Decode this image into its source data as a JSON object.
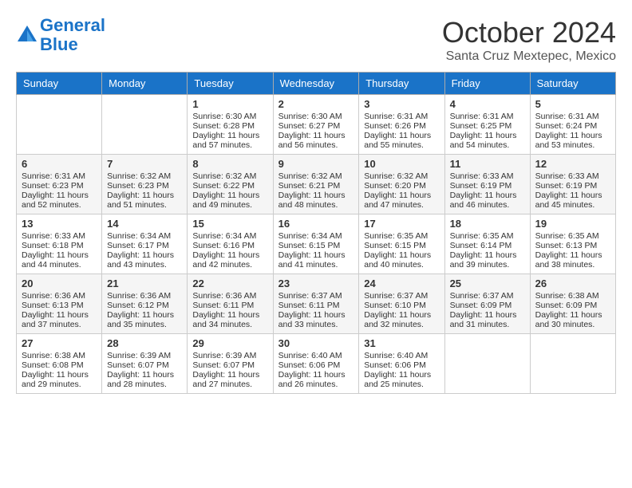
{
  "header": {
    "logo_line1": "General",
    "logo_line2": "Blue",
    "month": "October 2024",
    "location": "Santa Cruz Mextepec, Mexico"
  },
  "days_of_week": [
    "Sunday",
    "Monday",
    "Tuesday",
    "Wednesday",
    "Thursday",
    "Friday",
    "Saturday"
  ],
  "weeks": [
    [
      {
        "day": "",
        "sunrise": "",
        "sunset": "",
        "daylight": ""
      },
      {
        "day": "",
        "sunrise": "",
        "sunset": "",
        "daylight": ""
      },
      {
        "day": "1",
        "sunrise": "Sunrise: 6:30 AM",
        "sunset": "Sunset: 6:28 PM",
        "daylight": "Daylight: 11 hours and 57 minutes."
      },
      {
        "day": "2",
        "sunrise": "Sunrise: 6:30 AM",
        "sunset": "Sunset: 6:27 PM",
        "daylight": "Daylight: 11 hours and 56 minutes."
      },
      {
        "day": "3",
        "sunrise": "Sunrise: 6:31 AM",
        "sunset": "Sunset: 6:26 PM",
        "daylight": "Daylight: 11 hours and 55 minutes."
      },
      {
        "day": "4",
        "sunrise": "Sunrise: 6:31 AM",
        "sunset": "Sunset: 6:25 PM",
        "daylight": "Daylight: 11 hours and 54 minutes."
      },
      {
        "day": "5",
        "sunrise": "Sunrise: 6:31 AM",
        "sunset": "Sunset: 6:24 PM",
        "daylight": "Daylight: 11 hours and 53 minutes."
      }
    ],
    [
      {
        "day": "6",
        "sunrise": "Sunrise: 6:31 AM",
        "sunset": "Sunset: 6:23 PM",
        "daylight": "Daylight: 11 hours and 52 minutes."
      },
      {
        "day": "7",
        "sunrise": "Sunrise: 6:32 AM",
        "sunset": "Sunset: 6:23 PM",
        "daylight": "Daylight: 11 hours and 51 minutes."
      },
      {
        "day": "8",
        "sunrise": "Sunrise: 6:32 AM",
        "sunset": "Sunset: 6:22 PM",
        "daylight": "Daylight: 11 hours and 49 minutes."
      },
      {
        "day": "9",
        "sunrise": "Sunrise: 6:32 AM",
        "sunset": "Sunset: 6:21 PM",
        "daylight": "Daylight: 11 hours and 48 minutes."
      },
      {
        "day": "10",
        "sunrise": "Sunrise: 6:32 AM",
        "sunset": "Sunset: 6:20 PM",
        "daylight": "Daylight: 11 hours and 47 minutes."
      },
      {
        "day": "11",
        "sunrise": "Sunrise: 6:33 AM",
        "sunset": "Sunset: 6:19 PM",
        "daylight": "Daylight: 11 hours and 46 minutes."
      },
      {
        "day": "12",
        "sunrise": "Sunrise: 6:33 AM",
        "sunset": "Sunset: 6:19 PM",
        "daylight": "Daylight: 11 hours and 45 minutes."
      }
    ],
    [
      {
        "day": "13",
        "sunrise": "Sunrise: 6:33 AM",
        "sunset": "Sunset: 6:18 PM",
        "daylight": "Daylight: 11 hours and 44 minutes."
      },
      {
        "day": "14",
        "sunrise": "Sunrise: 6:34 AM",
        "sunset": "Sunset: 6:17 PM",
        "daylight": "Daylight: 11 hours and 43 minutes."
      },
      {
        "day": "15",
        "sunrise": "Sunrise: 6:34 AM",
        "sunset": "Sunset: 6:16 PM",
        "daylight": "Daylight: 11 hours and 42 minutes."
      },
      {
        "day": "16",
        "sunrise": "Sunrise: 6:34 AM",
        "sunset": "Sunset: 6:15 PM",
        "daylight": "Daylight: 11 hours and 41 minutes."
      },
      {
        "day": "17",
        "sunrise": "Sunrise: 6:35 AM",
        "sunset": "Sunset: 6:15 PM",
        "daylight": "Daylight: 11 hours and 40 minutes."
      },
      {
        "day": "18",
        "sunrise": "Sunrise: 6:35 AM",
        "sunset": "Sunset: 6:14 PM",
        "daylight": "Daylight: 11 hours and 39 minutes."
      },
      {
        "day": "19",
        "sunrise": "Sunrise: 6:35 AM",
        "sunset": "Sunset: 6:13 PM",
        "daylight": "Daylight: 11 hours and 38 minutes."
      }
    ],
    [
      {
        "day": "20",
        "sunrise": "Sunrise: 6:36 AM",
        "sunset": "Sunset: 6:13 PM",
        "daylight": "Daylight: 11 hours and 37 minutes."
      },
      {
        "day": "21",
        "sunrise": "Sunrise: 6:36 AM",
        "sunset": "Sunset: 6:12 PM",
        "daylight": "Daylight: 11 hours and 35 minutes."
      },
      {
        "day": "22",
        "sunrise": "Sunrise: 6:36 AM",
        "sunset": "Sunset: 6:11 PM",
        "daylight": "Daylight: 11 hours and 34 minutes."
      },
      {
        "day": "23",
        "sunrise": "Sunrise: 6:37 AM",
        "sunset": "Sunset: 6:11 PM",
        "daylight": "Daylight: 11 hours and 33 minutes."
      },
      {
        "day": "24",
        "sunrise": "Sunrise: 6:37 AM",
        "sunset": "Sunset: 6:10 PM",
        "daylight": "Daylight: 11 hours and 32 minutes."
      },
      {
        "day": "25",
        "sunrise": "Sunrise: 6:37 AM",
        "sunset": "Sunset: 6:09 PM",
        "daylight": "Daylight: 11 hours and 31 minutes."
      },
      {
        "day": "26",
        "sunrise": "Sunrise: 6:38 AM",
        "sunset": "Sunset: 6:09 PM",
        "daylight": "Daylight: 11 hours and 30 minutes."
      }
    ],
    [
      {
        "day": "27",
        "sunrise": "Sunrise: 6:38 AM",
        "sunset": "Sunset: 6:08 PM",
        "daylight": "Daylight: 11 hours and 29 minutes."
      },
      {
        "day": "28",
        "sunrise": "Sunrise: 6:39 AM",
        "sunset": "Sunset: 6:07 PM",
        "daylight": "Daylight: 11 hours and 28 minutes."
      },
      {
        "day": "29",
        "sunrise": "Sunrise: 6:39 AM",
        "sunset": "Sunset: 6:07 PM",
        "daylight": "Daylight: 11 hours and 27 minutes."
      },
      {
        "day": "30",
        "sunrise": "Sunrise: 6:40 AM",
        "sunset": "Sunset: 6:06 PM",
        "daylight": "Daylight: 11 hours and 26 minutes."
      },
      {
        "day": "31",
        "sunrise": "Sunrise: 6:40 AM",
        "sunset": "Sunset: 6:06 PM",
        "daylight": "Daylight: 11 hours and 25 minutes."
      },
      {
        "day": "",
        "sunrise": "",
        "sunset": "",
        "daylight": ""
      },
      {
        "day": "",
        "sunrise": "",
        "sunset": "",
        "daylight": ""
      }
    ]
  ]
}
